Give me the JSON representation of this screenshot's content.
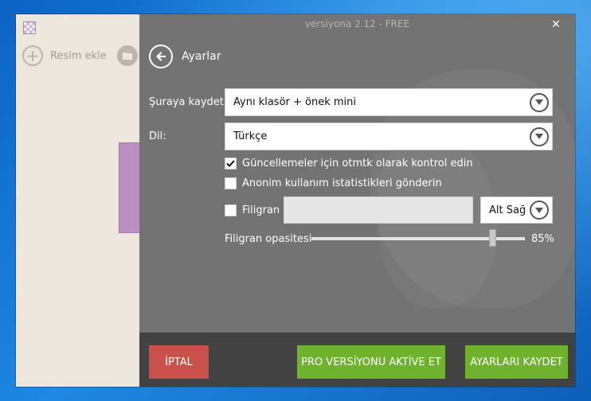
{
  "window": {
    "title": "versiyona 2.12 - FREE",
    "close_symbol": "✕"
  },
  "background_app": {
    "add_image_label": "Resim ekle",
    "icons": [
      "plus-circle-icon",
      "folder-icon"
    ]
  },
  "header": {
    "title": "Ayarlar",
    "back_icon": "arrow-left-circle-icon"
  },
  "settings": {
    "save_to": {
      "label": "Şuraya kaydet:",
      "value": "Aynı klasör + önek mini"
    },
    "language": {
      "label": "Dil:",
      "value": "Türkçe"
    },
    "auto_update": {
      "label": "Güncellemeler için otmtk olarak kontrol edin",
      "checked": true
    },
    "anonymous_stats": {
      "label": "Anonim kullanım istatistikleri gönderin",
      "checked": false
    },
    "watermark": {
      "label": "Filigran",
      "checked": false,
      "text_value": "",
      "position_value": "Alt Sağ"
    },
    "watermark_opacity": {
      "label": "Filigran opasitesi",
      "value_text": "85%",
      "value": 0.85
    }
  },
  "footer": {
    "cancel_label": "İPTAL",
    "pro_label": "PRO VERSİYONU AKTİVE ET",
    "save_label": "AYARLARI KAYDET"
  },
  "colors": {
    "panel_bg": "#737373",
    "footer_bg": "#424242",
    "cancel": "#c9504b",
    "accent_green": "#6fb22e",
    "desktop_blue": "#1f88e0"
  }
}
